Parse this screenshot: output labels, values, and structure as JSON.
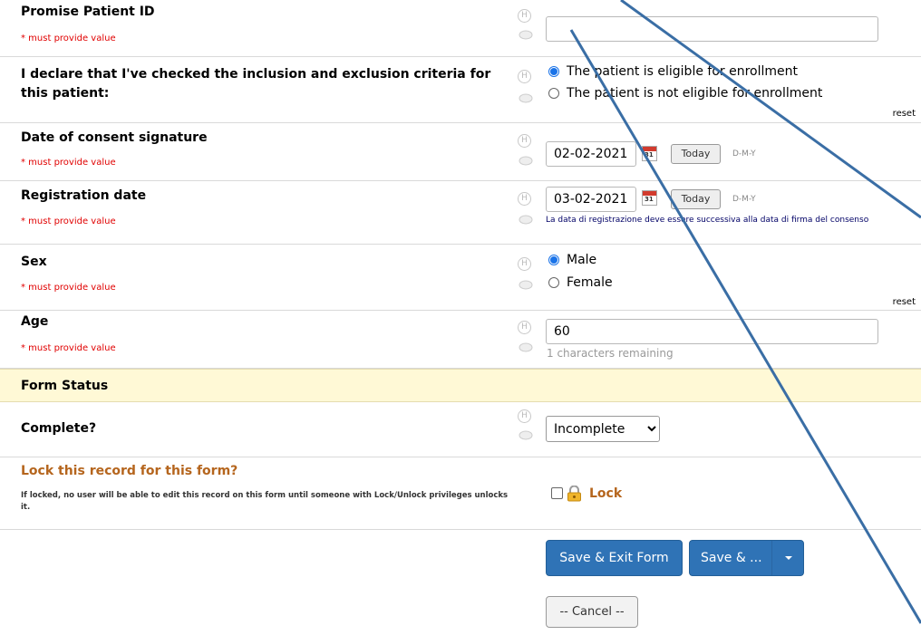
{
  "fields": {
    "patient_id": {
      "label": "Promise Patient ID",
      "required": "* must provide value",
      "value": ""
    },
    "eligibility": {
      "label": "I declare that I've checked the inclusion and exclusion criteria for this patient:",
      "options": [
        "The patient is eligible for enrollment",
        "The patient is not eligible for enrollment"
      ],
      "selected": 0,
      "reset": "reset"
    },
    "consent_date": {
      "label": "Date of consent signature",
      "required": "* must provide value",
      "value": "02-02-2021",
      "today": "Today",
      "format": "D-M-Y"
    },
    "registration_date": {
      "label": "Registration date",
      "required": "* must provide value",
      "value": "03-02-2021",
      "today": "Today",
      "format": "D-M-Y",
      "note": "La data di registrazione deve essere successiva alla data di firma del consenso"
    },
    "sex": {
      "label": "Sex",
      "required": "* must provide value",
      "options": [
        "Male",
        "Female"
      ],
      "selected": 0,
      "reset": "reset"
    },
    "age": {
      "label": "Age",
      "required": "* must provide value",
      "value": "60",
      "remaining": "1 characters remaining"
    }
  },
  "form_status": {
    "header": "Form Status",
    "complete_label": "Complete?",
    "complete_value": "Incomplete",
    "lock_title": "Lock this record for this form?",
    "lock_desc": "If locked, no user will be able to edit this record on this form until someone with Lock/Unlock privileges unlocks it.",
    "lock_label": "Lock"
  },
  "actions": {
    "save_exit": "Save & Exit Form",
    "save_more": "Save & ...",
    "cancel": "-- Cancel --"
  },
  "icons": {
    "history": "H",
    "comment": "comment-icon",
    "calendar": "31",
    "lock": "padlock-icon",
    "dropdown": "caret-down-icon"
  },
  "colors": {
    "required": "#e00000",
    "primary_button": "#2f73b6",
    "section_bg": "#fff9d6",
    "lock_text": "#b5651d",
    "annotation": "#3a6ea5"
  }
}
